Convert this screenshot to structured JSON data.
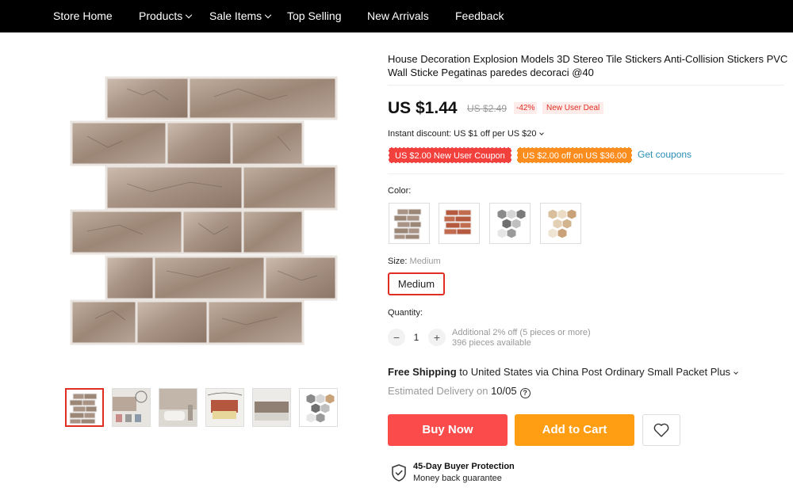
{
  "nav": {
    "items": [
      {
        "label": "Store Home",
        "dropdown": false
      },
      {
        "label": "Products",
        "dropdown": true
      },
      {
        "label": "Sale Items",
        "dropdown": true
      },
      {
        "label": "Top Selling",
        "dropdown": false
      },
      {
        "label": "New Arrivals",
        "dropdown": false
      },
      {
        "label": "Feedback",
        "dropdown": false
      }
    ]
  },
  "gallery": {
    "main_image": "grey-stone-brick-tile-sticker",
    "thumbnails": [
      "grey-brick-tile",
      "room-with-brick-wall",
      "bathroom-tile-wall",
      "living-room-red-brick",
      "kitchen-backsplash-tile",
      "hexagon-mosaic-tile"
    ],
    "active_thumbnail": 0
  },
  "product": {
    "title": "House Decoration Explosion Models 3D Stereo Tile Stickers Anti-Collision Stickers PVC Wall Sticke Pegatinas paredes decoraci @40",
    "price": "US $1.44",
    "original_price": "US $2.49",
    "discount": "-42%",
    "deal_badge": "New User Deal",
    "instant_discount": "Instant discount: US $1 off per US $20",
    "coupons": [
      "US $2.00 New User Coupon",
      "US $2.00 off on US $36.00"
    ],
    "get_coupons": "Get coupons"
  },
  "options": {
    "color_label": "Color:",
    "color_swatches": [
      "grey-brick",
      "red-brick",
      "grey-hexagon",
      "beige-hexagon"
    ],
    "size_label": "Size:",
    "size_selected_display": "Medium",
    "size_button": "Medium",
    "quantity_label": "Quantity:",
    "quantity_value": "1",
    "qty_minus": "−",
    "qty_plus": "+",
    "additional_discount": "Additional 2% off (5 pieces or more)",
    "stock": "396 pieces available"
  },
  "shipping": {
    "free_label": "Free Shipping",
    "detail": " to United States via China Post Ordinary Small Packet Plus",
    "delivery_label": "Estimated Delivery on ",
    "delivery_date": "10/05"
  },
  "actions": {
    "buy_now": "Buy Now",
    "add_to_cart": "Add to Cart"
  },
  "protection": {
    "title": "45-Day Buyer Protection",
    "subtitle": "Money back guarantee"
  },
  "colors": {
    "nav_bg": "#000000",
    "accent_red": "#e02e24",
    "buy_btn": "#fb4b4b",
    "cart_btn": "#ff9d13",
    "coupon_red": "#f2403d",
    "coupon_orange": "#fb8c1e",
    "link_blue": "#2a8fb6"
  }
}
